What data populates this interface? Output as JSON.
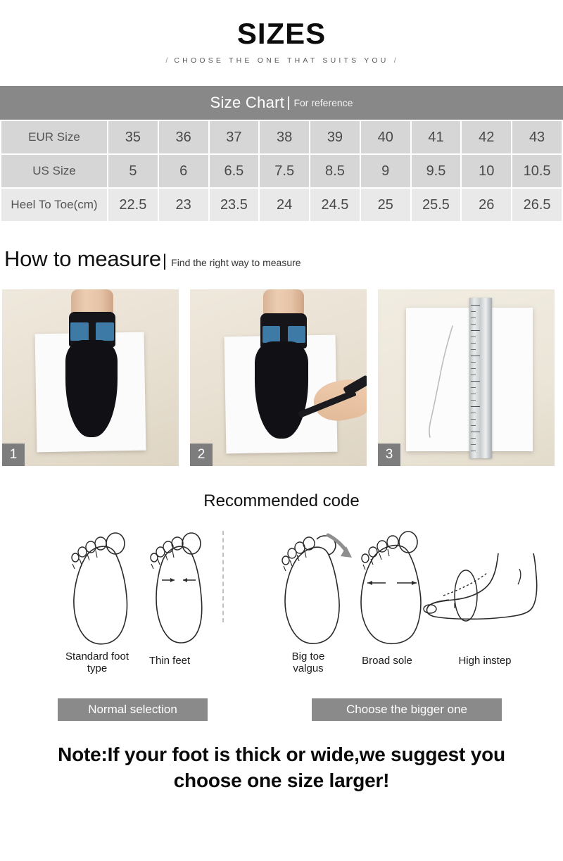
{
  "header": {
    "title": "SIZES",
    "slash_left": "/",
    "subtitle": "CHOOSE THE ONE THAT SUITS YOU",
    "slash_right": "/"
  },
  "size_chart": {
    "banner_title": "Size Chart",
    "banner_divider": "|",
    "banner_subtitle": "For reference",
    "rows": [
      {
        "label": "EUR Size",
        "values": [
          "35",
          "36",
          "37",
          "38",
          "39",
          "40",
          "41",
          "42",
          "43"
        ]
      },
      {
        "label": "US Size",
        "values": [
          "5",
          "6",
          "6.5",
          "7.5",
          "8.5",
          "9",
          "9.5",
          "10",
          "10.5"
        ]
      },
      {
        "label": "Heel To Toe(cm)",
        "values": [
          "22.5",
          "23",
          "23.5",
          "24",
          "24.5",
          "25",
          "25.5",
          "26",
          "26.5"
        ]
      }
    ]
  },
  "measure": {
    "title": "How to measure",
    "divider": "|",
    "subtitle": "Find the right way to measure",
    "steps": [
      {
        "badge": "1",
        "alt": "foot-in-black-sock-standing-on-white-paper"
      },
      {
        "badge": "2",
        "alt": "hand-tracing-foot-outline-with-pen-on-paper"
      },
      {
        "badge": "3",
        "alt": "measuring-traced-outline-with-metal-ruler"
      }
    ]
  },
  "recommended": {
    "title": "Recommended code",
    "figures": [
      {
        "label_line1": "Standard foot",
        "label_line2": "type",
        "icon": "standard-foot-sole-outline"
      },
      {
        "label_line1": "Thin feet",
        "label_line2": "",
        "icon": "thin-foot-sole-outline-inward-arrows"
      },
      {
        "label_line1": "Big toe",
        "label_line2": "valgus",
        "icon": "big-toe-valgus-sole-outline-arrow"
      },
      {
        "label_line1": "Broad sole",
        "label_line2": "",
        "icon": "broad-sole-outline-outward-arrows"
      },
      {
        "label_line1": "High instep",
        "label_line2": "",
        "icon": "high-instep-side-foot-outline"
      }
    ],
    "buttons": [
      {
        "label": "Normal selection"
      },
      {
        "label": "Choose the bigger one"
      }
    ]
  },
  "note": {
    "line1": "Note:If your foot is thick or wide,we suggest you",
    "line2": "choose one size larger!"
  },
  "colors": {
    "banner_gray": "#888888",
    "cell_gray": "#d6d6d6",
    "cell_light": "#e9e9e9",
    "button_gray": "#8a8a8a",
    "badge_gray": "#7d7d7d"
  }
}
